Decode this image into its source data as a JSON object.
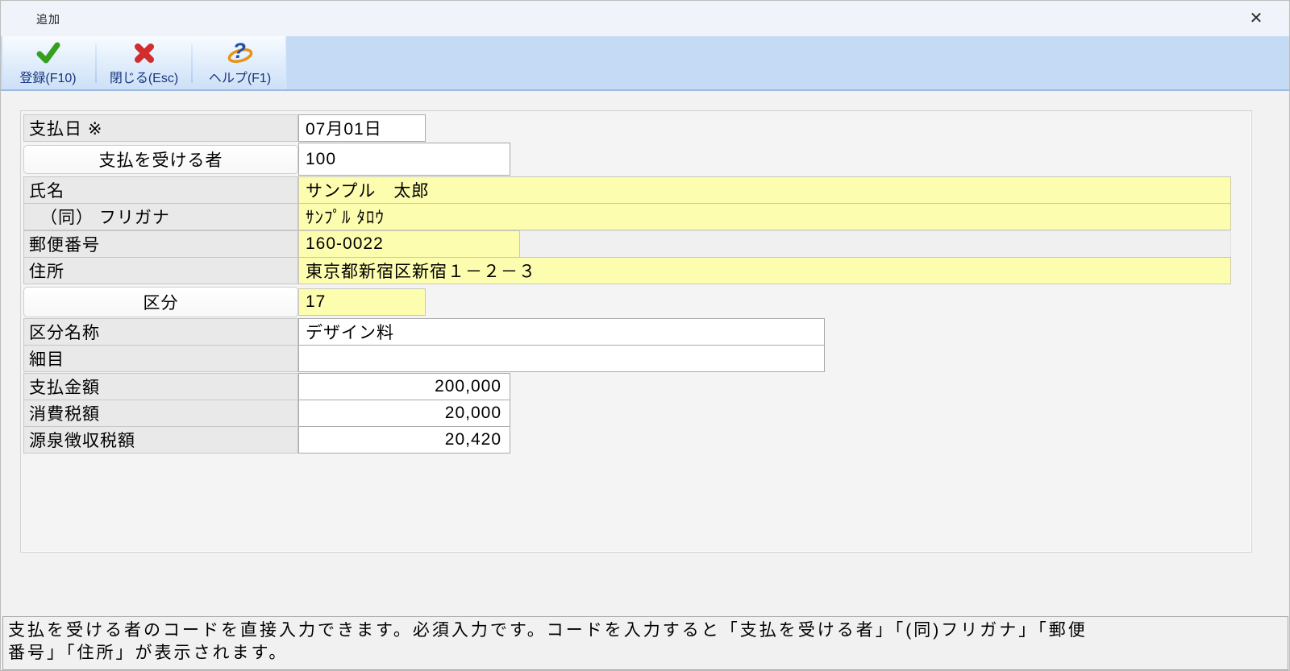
{
  "window": {
    "title": "追加",
    "close_glyph": "✕"
  },
  "toolbar": {
    "buttons": [
      {
        "label": "登録(F10)"
      },
      {
        "label": "閉じる(Esc)"
      },
      {
        "label": "ヘルプ(F1)"
      }
    ]
  },
  "form": {
    "rows": [
      {
        "label": "支払日 ※",
        "value": "07月01日"
      },
      {
        "label": "支払を受ける者",
        "value": "100"
      },
      {
        "label": "氏名",
        "value": "サンプル　太郎"
      },
      {
        "label": "（同） フリガナ",
        "value": "ｻﾝﾌﾟﾙ ﾀﾛｳ"
      },
      {
        "label": "郵便番号",
        "value": "160-0022"
      },
      {
        "label": "住所",
        "value": "東京都新宿区新宿１－２－３"
      },
      {
        "label": "区分",
        "value": "17"
      },
      {
        "label": "区分名称",
        "value": "デザイン料"
      },
      {
        "label": "細目",
        "value": ""
      },
      {
        "label": "支払金額",
        "value": "200,000"
      },
      {
        "label": "消費税額",
        "value": "20,000"
      },
      {
        "label": "源泉徴収税額",
        "value": "20,420"
      }
    ]
  },
  "status": {
    "lines": [
      "支払を受ける者のコードを直接入力できます。必須入力です。コードを入力すると「支払を受ける者」「(同)フリガナ」「郵便",
      "番号」「住所」が表示されます。"
    ]
  },
  "colors": {
    "field_yellow": "#fdfdb0",
    "toolbar_blue": "#c5dbf5",
    "label_gray": "#e9e9e9",
    "check_green": "#35a01e",
    "close_red": "#d22d2d",
    "help_blue": "#1d4fae",
    "help_orange": "#e89214"
  }
}
